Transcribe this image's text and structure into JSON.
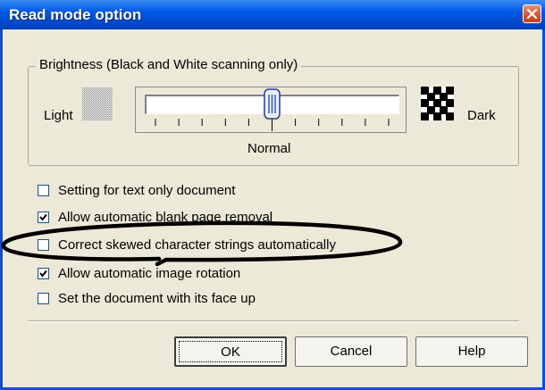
{
  "window": {
    "title": "Read mode option"
  },
  "brightness": {
    "group_label": "Brightness (Black and White scanning only)",
    "left_label": "Light",
    "right_label": "Dark",
    "center_label": "Normal",
    "tick_count": 11,
    "value_fraction": 0.5
  },
  "options": [
    {
      "label": "Setting for text only document",
      "checked": false
    },
    {
      "label": "Allow automatic blank page removal",
      "checked": true
    },
    {
      "label": "Correct skewed character strings automatically",
      "checked": false
    },
    {
      "label": "Allow automatic image rotation",
      "checked": true
    },
    {
      "label": "Set the document with its face up",
      "checked": false
    }
  ],
  "buttons": {
    "ok": "OK",
    "cancel": "Cancel",
    "help": "Help"
  },
  "icons": {
    "close": "close-icon",
    "light": "light-pattern-icon",
    "dark": "dark-pattern-icon",
    "check": "check-icon"
  },
  "colors": {
    "titlebar": "#0058e6",
    "close_button": "#d6532b",
    "dialog_bg": "#ece9d8",
    "annotation_ellipse": "#000000"
  }
}
